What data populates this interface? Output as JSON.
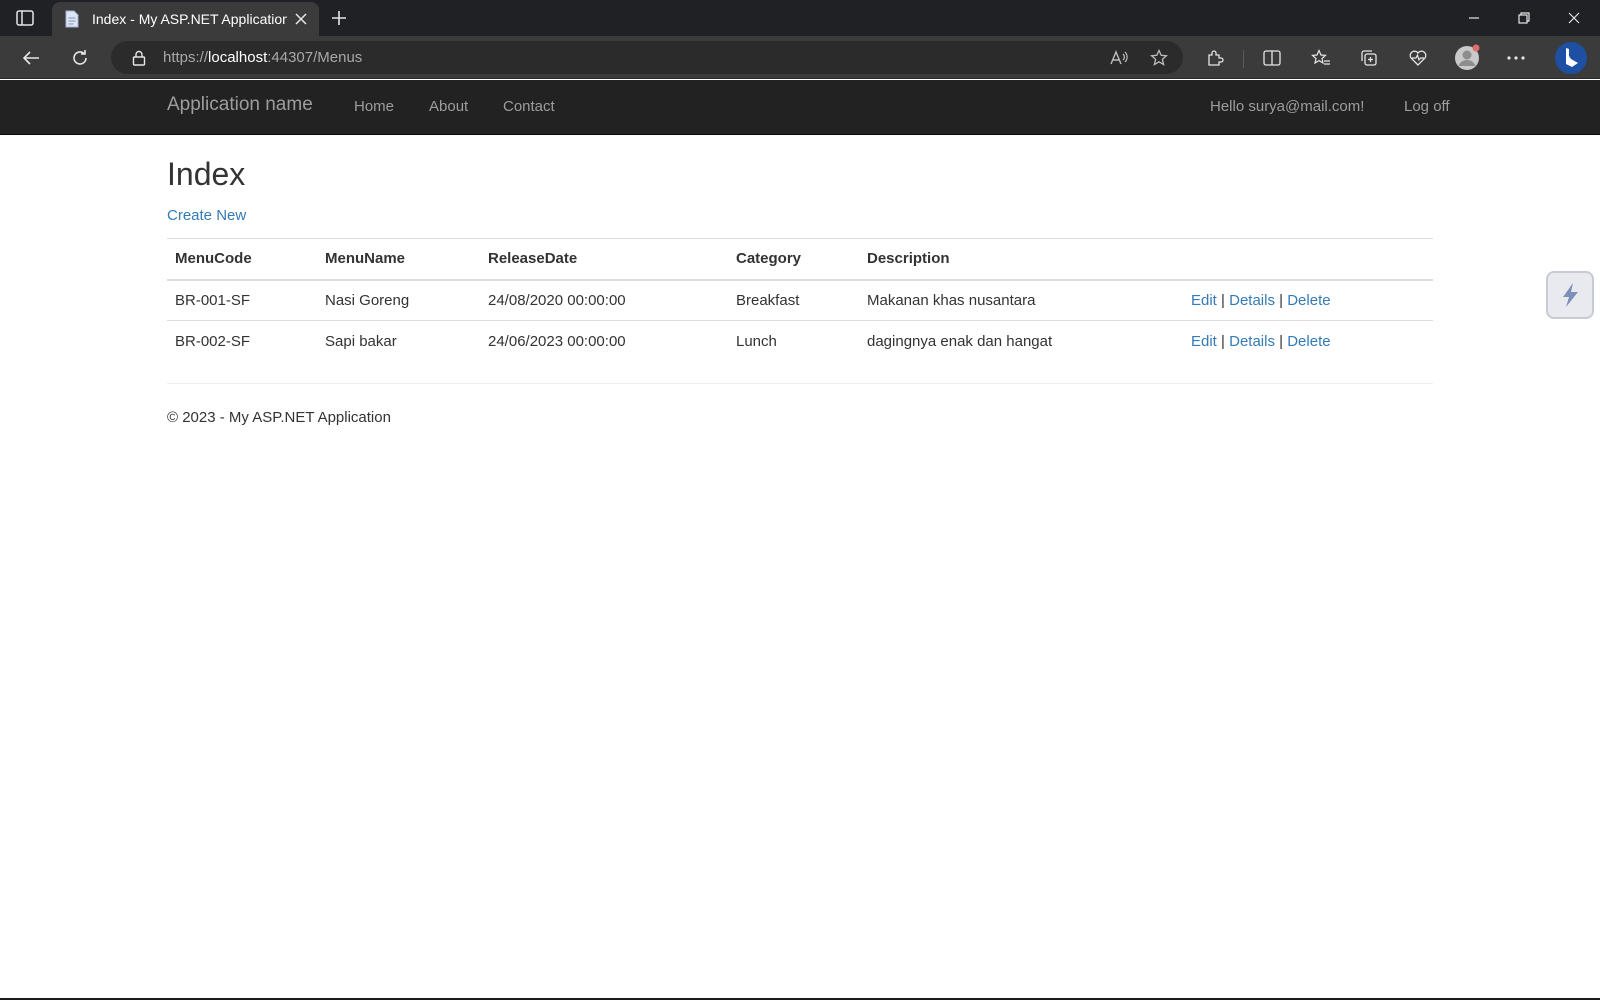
{
  "browser": {
    "tab_title": "Index - My ASP.NET Application",
    "url_prefix": "https://",
    "url_host": "localhost",
    "url_path": ":44307/Menus",
    "icons": [
      "sidebar-icon",
      "page-icon",
      "close-icon",
      "plus-icon",
      "minimize-icon",
      "restore-icon",
      "window-close-icon",
      "back-icon",
      "refresh-icon",
      "lock-icon",
      "read-aloud-icon",
      "star-icon",
      "extensions-icon",
      "split-screen-icon",
      "favorites-icon",
      "collections-icon",
      "health-icon",
      "profile-icon",
      "more-icon",
      "bing-copilot-icon"
    ]
  },
  "navbar": {
    "brand": "Application name",
    "links": [
      "Home",
      "About",
      "Contact"
    ],
    "greeting": "Hello surya@mail.com!",
    "logoff": "Log off"
  },
  "page": {
    "title": "Index",
    "create_new": "Create New"
  },
  "table": {
    "headers": [
      "MenuCode",
      "MenuName",
      "ReleaseDate",
      "Category",
      "Description"
    ],
    "rows": [
      {
        "code": "BR-001-SF",
        "name": "Nasi Goreng",
        "date": "24/08/2020 00:00:00",
        "category": "Breakfast",
        "description": "Makanan khas nusantara"
      },
      {
        "code": "BR-002-SF",
        "name": "Sapi bakar",
        "date": "24/06/2023 00:00:00",
        "category": "Lunch",
        "description": "dagingnya enak dan hangat"
      }
    ],
    "actions": {
      "edit": "Edit",
      "details": "Details",
      "delete": "Delete",
      "separator": "|"
    }
  },
  "footer": {
    "text": "© 2023 - My ASP.NET Application"
  },
  "colors": {
    "navbar_bg": "#222222",
    "nav_text": "#9d9d9d",
    "link": "#337ab7",
    "chrome_dark": "#202124",
    "chrome_toolbar": "#3b3b3b"
  }
}
